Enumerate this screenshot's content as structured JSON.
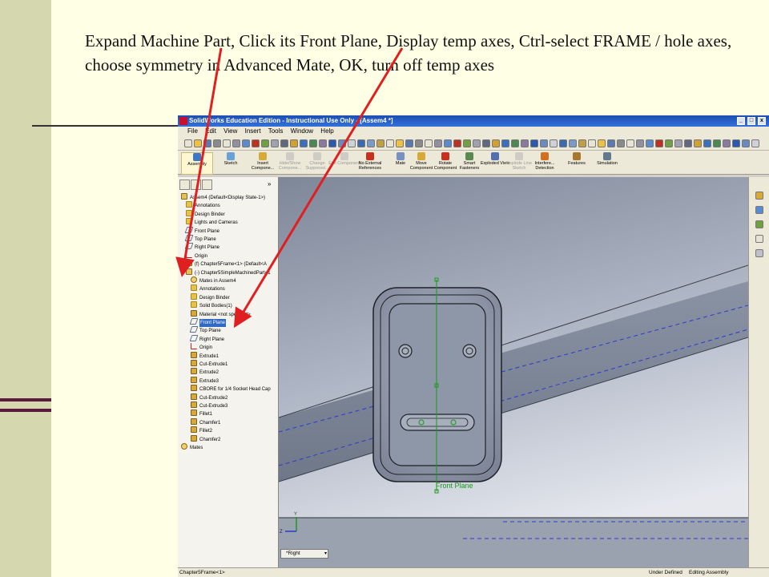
{
  "slide": {
    "instruction": "Expand Machine Part, Click its Front Plane, Display temp axes, Ctrl-select FRAME / hole axes, choose symmetry in Advanced Mate, OK, turn off temp axes"
  },
  "window": {
    "title": "SolidWorks Education Edition - Instructional Use Only - [Assem4 *]",
    "controls": [
      "_",
      "□",
      "x"
    ]
  },
  "menus": [
    "File",
    "Edit",
    "View",
    "Insert",
    "Tools",
    "Window",
    "Help"
  ],
  "command_manager": [
    {
      "label": "Assembly",
      "state": "active",
      "color": "#3A78C8"
    },
    {
      "label": "Sketch",
      "state": "normal",
      "color": "#6AA0D8"
    },
    {
      "label": "Insert Compone...",
      "state": "normal",
      "color": "#D8A838"
    },
    {
      "label": "Hide/Show Compone...",
      "state": "disabled",
      "color": "#B0B0B0"
    },
    {
      "label": "Change Suppressi...",
      "state": "disabled",
      "color": "#B0B0B0"
    },
    {
      "label": "Edit Component",
      "state": "disabled",
      "color": "#B0B0B0"
    },
    {
      "label": "No External References",
      "state": "normal",
      "color": "#C83020"
    },
    {
      "label": "Mate",
      "state": "normal",
      "color": "#7890C0"
    },
    {
      "label": "Move Component",
      "state": "normal",
      "color": "#D8A838"
    },
    {
      "label": "Rotate Component",
      "state": "normal",
      "color": "#C83020"
    },
    {
      "label": "Smart Fasteners",
      "state": "normal",
      "color": "#5A8A50"
    },
    {
      "label": "Exploded View",
      "state": "normal",
      "color": "#5070B0"
    },
    {
      "label": "Explode Line Sketch",
      "state": "disabled",
      "color": "#B0B0B0"
    },
    {
      "label": "Interfere... Detection",
      "state": "normal",
      "color": "#D07020"
    },
    {
      "label": "Features",
      "state": "normal",
      "color": "#A87830"
    },
    {
      "label": "Simulation",
      "state": "normal",
      "color": "#607890"
    }
  ],
  "feature_tree": [
    {
      "label": "Assem4  (Default<Display State-1>)",
      "indent": 0,
      "icon": "part",
      "selected": false
    },
    {
      "label": "Annotations",
      "indent": 1,
      "icon": "folder",
      "selected": false
    },
    {
      "label": "Design Binder",
      "indent": 1,
      "icon": "folder",
      "selected": false
    },
    {
      "label": "Lights and Cameras",
      "indent": 1,
      "icon": "folder",
      "selected": false
    },
    {
      "label": "Front Plane",
      "indent": 1,
      "icon": "plane",
      "selected": false
    },
    {
      "label": "Top Plane",
      "indent": 1,
      "icon": "plane",
      "selected": false
    },
    {
      "label": "Right Plane",
      "indent": 1,
      "icon": "plane",
      "selected": false
    },
    {
      "label": "Origin",
      "indent": 1,
      "icon": "origin",
      "selected": false
    },
    {
      "label": "(f) Chapter5Frame<1> (Default<A",
      "indent": 1,
      "icon": "part",
      "selected": false
    },
    {
      "label": "(-) Chapter5SimpleMachinedPart<1",
      "indent": 1,
      "icon": "part",
      "selected": false
    },
    {
      "label": "Mates in Assem4",
      "indent": 2,
      "icon": "mate",
      "selected": false
    },
    {
      "label": "Annotations",
      "indent": 2,
      "icon": "folder",
      "selected": false
    },
    {
      "label": "Design Binder",
      "indent": 2,
      "icon": "folder",
      "selected": false
    },
    {
      "label": "Solid Bodies(1)",
      "indent": 2,
      "icon": "folder",
      "selected": false
    },
    {
      "label": "Material <not specified>",
      "indent": 2,
      "icon": "feat",
      "selected": false
    },
    {
      "label": "Front Plane",
      "indent": 2,
      "icon": "plane",
      "selected": true
    },
    {
      "label": "Top Plane",
      "indent": 2,
      "icon": "plane",
      "selected": false
    },
    {
      "label": "Right Plane",
      "indent": 2,
      "icon": "plane",
      "selected": false
    },
    {
      "label": "Origin",
      "indent": 2,
      "icon": "origin",
      "selected": false
    },
    {
      "label": "Extrude1",
      "indent": 2,
      "icon": "feat",
      "selected": false
    },
    {
      "label": "Cut-Extrude1",
      "indent": 2,
      "icon": "feat",
      "selected": false
    },
    {
      "label": "Extrude2",
      "indent": 2,
      "icon": "feat",
      "selected": false
    },
    {
      "label": "Extrude3",
      "indent": 2,
      "icon": "feat",
      "selected": false
    },
    {
      "label": "CBORE for 1/4 Socket Head Cap",
      "indent": 2,
      "icon": "feat",
      "selected": false
    },
    {
      "label": "Cut-Extrude2",
      "indent": 2,
      "icon": "feat",
      "selected": false
    },
    {
      "label": "Cut-Extrude3",
      "indent": 2,
      "icon": "feat",
      "selected": false
    },
    {
      "label": "Fillet1",
      "indent": 2,
      "icon": "feat",
      "selected": false
    },
    {
      "label": "Chamfer1",
      "indent": 2,
      "icon": "feat",
      "selected": false
    },
    {
      "label": "Fillet2",
      "indent": 2,
      "icon": "feat",
      "selected": false
    },
    {
      "label": "Chamfer2",
      "indent": 2,
      "icon": "feat",
      "selected": false
    },
    {
      "label": "Mates",
      "indent": 0,
      "icon": "mate",
      "selected": false
    }
  ],
  "viewport": {
    "plane_label": "Front Plane",
    "view_orientation": "*Right",
    "axis_labels": [
      "Y",
      "Z"
    ]
  },
  "status": {
    "left": "Chapter5Frame<1>",
    "definition": "Under Defined",
    "mode": "Editing Assembly"
  },
  "colors": {
    "annotation_arrow": "#E02020",
    "selection": "#316AC5",
    "temp_axis": "#1A9A1A",
    "hidden_edge": "#2A3AD0"
  }
}
